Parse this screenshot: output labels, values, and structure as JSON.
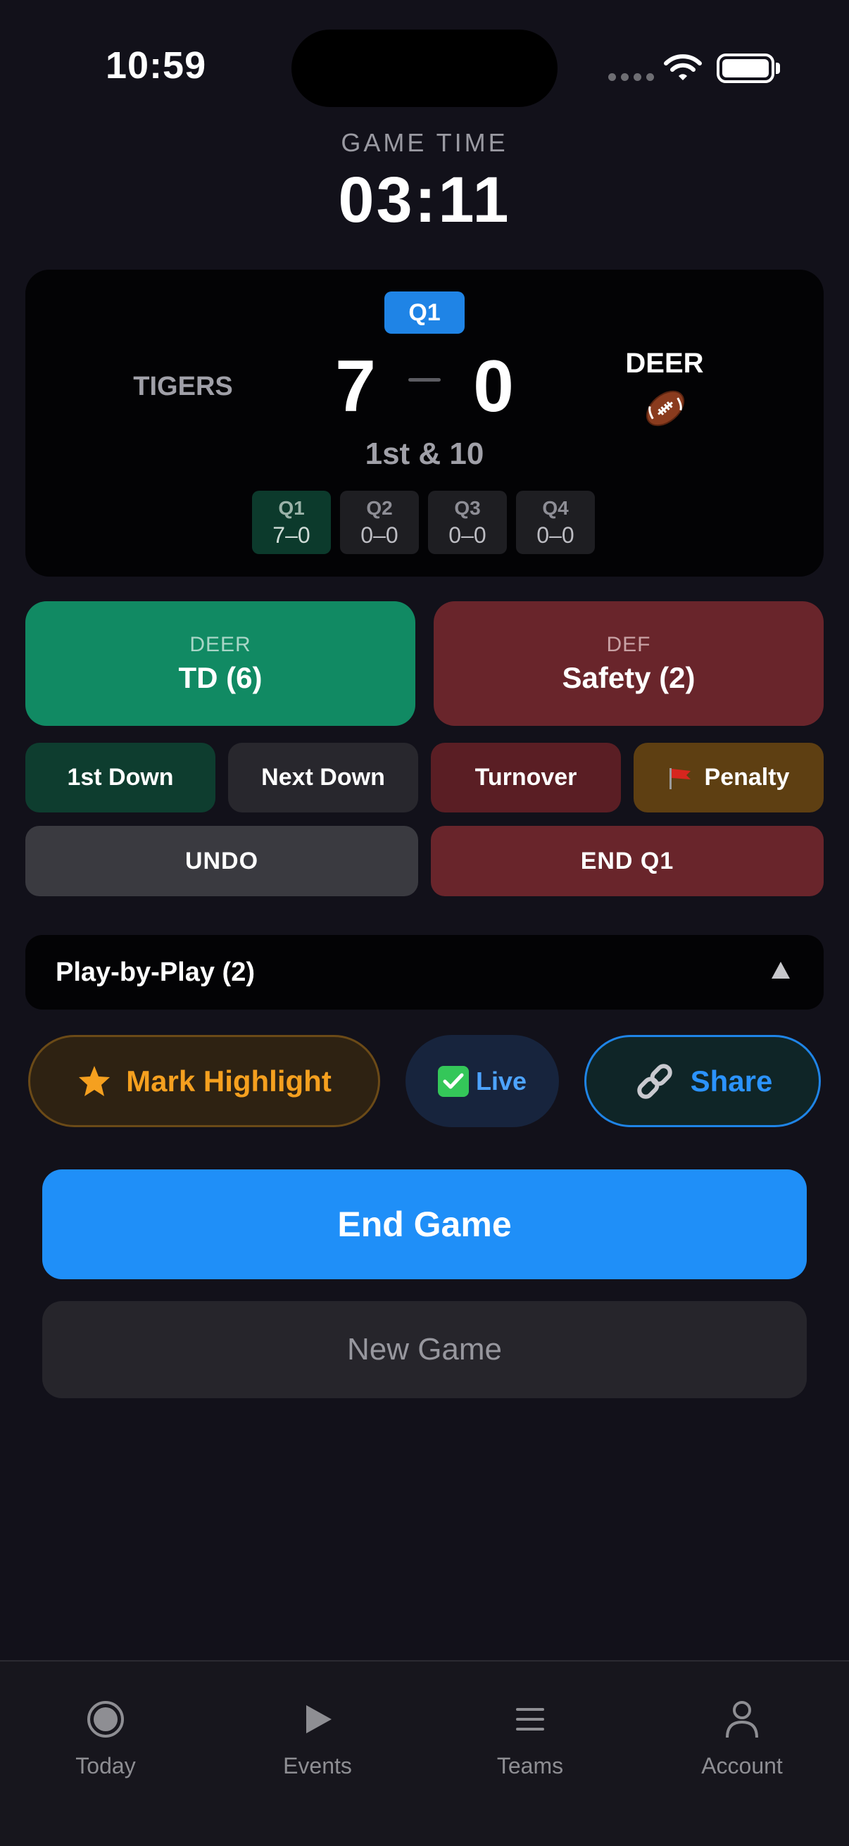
{
  "status_bar": {
    "time": "10:59"
  },
  "game_time": {
    "label": "GAME TIME",
    "value": "03:11"
  },
  "scoreboard": {
    "quarter_badge": "Q1",
    "home": {
      "name": "TIGERS",
      "score": "7"
    },
    "away": {
      "name": "DEER",
      "score": "0",
      "possession_icon": "football-icon"
    },
    "down_distance": "1st & 10",
    "quarters": [
      {
        "label": "Q1",
        "score": "7–0",
        "active": true
      },
      {
        "label": "Q2",
        "score": "0–0",
        "active": false
      },
      {
        "label": "Q3",
        "score": "0–0",
        "active": false
      },
      {
        "label": "Q4",
        "score": "0–0",
        "active": false
      }
    ]
  },
  "scoring": {
    "td": {
      "team": "DEER",
      "label": "TD (6)"
    },
    "safety": {
      "team": "DEF",
      "label": "Safety (2)"
    }
  },
  "controls": {
    "first_down": "1st Down",
    "next_down": "Next Down",
    "turnover": "Turnover",
    "penalty": "Penalty",
    "undo": "UNDO",
    "end_quarter": "END Q1"
  },
  "play_by_play": {
    "title": "Play-by-Play (2)"
  },
  "actions": {
    "highlight": "Mark Highlight",
    "live": "Live",
    "share": "Share"
  },
  "game_buttons": {
    "end": "End Game",
    "new": "New Game"
  },
  "tabs": [
    {
      "label": "Today",
      "icon": "record-icon"
    },
    {
      "label": "Events",
      "icon": "play-icon"
    },
    {
      "label": "Teams",
      "icon": "list-icon"
    },
    {
      "label": "Account",
      "icon": "person-icon"
    }
  ],
  "colors": {
    "background": "#12111a",
    "accent_blue": "#1f8ff8",
    "td_green": "#118a63",
    "safety_red": "#69252b",
    "highlight_orange": "#f5a01f"
  }
}
